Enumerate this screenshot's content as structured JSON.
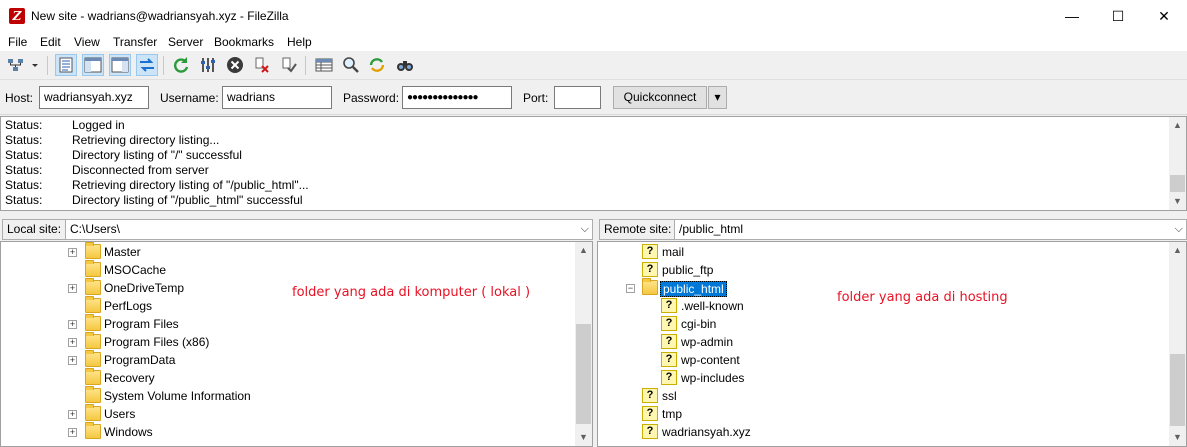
{
  "window": {
    "title": "New site - wadrians@wadriansyah.xyz - FileZilla",
    "app_icon": "filezilla-icon",
    "minimize": "—",
    "maximize": "☐",
    "close": "✕"
  },
  "menu": [
    "File",
    "Edit",
    "View",
    "Transfer",
    "Server",
    "Bookmarks",
    "Help"
  ],
  "quickconnect": {
    "host_label": "Host:",
    "host_value": "wadriansyah.xyz",
    "username_label": "Username:",
    "username_value": "wadrians",
    "password_label": "Password:",
    "password_value": "●●●●●●●●●●●●●●",
    "port_label": "Port:",
    "port_value": "",
    "button_label": "Quickconnect",
    "dropdown_arrow": "▾"
  },
  "log": [
    {
      "label": "Status:",
      "message": "Logged in"
    },
    {
      "label": "Status:",
      "message": "Retrieving directory listing..."
    },
    {
      "label": "Status:",
      "message": "Directory listing of \"/\" successful"
    },
    {
      "label": "Status:",
      "message": "Disconnected from server"
    },
    {
      "label": "Status:",
      "message": "Retrieving directory listing of \"/public_html\"..."
    },
    {
      "label": "Status:",
      "message": "Directory listing of \"/public_html\" successful"
    }
  ],
  "local": {
    "site_label": "Local site:",
    "path": "C:\\Users\\",
    "annotation": "folder yang ada di komputer ( lokal )",
    "items": [
      {
        "name": "Master",
        "expandable": true
      },
      {
        "name": "MSOCache",
        "expandable": false
      },
      {
        "name": "OneDriveTemp",
        "expandable": true
      },
      {
        "name": "PerfLogs",
        "expandable": false
      },
      {
        "name": "Program Files",
        "expandable": true
      },
      {
        "name": "Program Files (x86)",
        "expandable": true
      },
      {
        "name": "ProgramData",
        "expandable": true
      },
      {
        "name": "Recovery",
        "expandable": false
      },
      {
        "name": "System Volume Information",
        "expandable": false
      },
      {
        "name": "Users",
        "expandable": true
      },
      {
        "name": "Windows",
        "expandable": true
      }
    ]
  },
  "remote": {
    "site_label": "Remote site:",
    "path": "/public_html",
    "annotation": "folder yang ada di hosting",
    "items": [
      {
        "name": "mail",
        "depth": 0,
        "type": "unknown"
      },
      {
        "name": "public_ftp",
        "depth": 0,
        "type": "unknown"
      },
      {
        "name": "public_html",
        "depth": 0,
        "type": "folder",
        "selected": true,
        "expanded": true
      },
      {
        "name": ".well-known",
        "depth": 1,
        "type": "unknown"
      },
      {
        "name": "cgi-bin",
        "depth": 1,
        "type": "unknown"
      },
      {
        "name": "wp-admin",
        "depth": 1,
        "type": "unknown"
      },
      {
        "name": "wp-content",
        "depth": 1,
        "type": "unknown"
      },
      {
        "name": "wp-includes",
        "depth": 1,
        "type": "unknown"
      },
      {
        "name": "ssl",
        "depth": 0,
        "type": "unknown"
      },
      {
        "name": "tmp",
        "depth": 0,
        "type": "unknown"
      },
      {
        "name": "wadriansyah.xyz",
        "depth": 0,
        "type": "unknown"
      }
    ]
  },
  "toolbar_icons": [
    "site-manager-icon",
    "dropdown-arrow-icon",
    "toggle-log-icon",
    "toggle-local-tree-icon",
    "toggle-remote-tree-icon",
    "toggle-queue-icon",
    "refresh-icon",
    "process-queue-icon",
    "cancel-icon",
    "disconnect-icon",
    "reconnect-icon",
    "directory-filter-icon",
    "compare-icon",
    "sync-browsing-icon",
    "search-icon"
  ],
  "scroll_arrows": {
    "up": "▲",
    "down": "▼"
  }
}
